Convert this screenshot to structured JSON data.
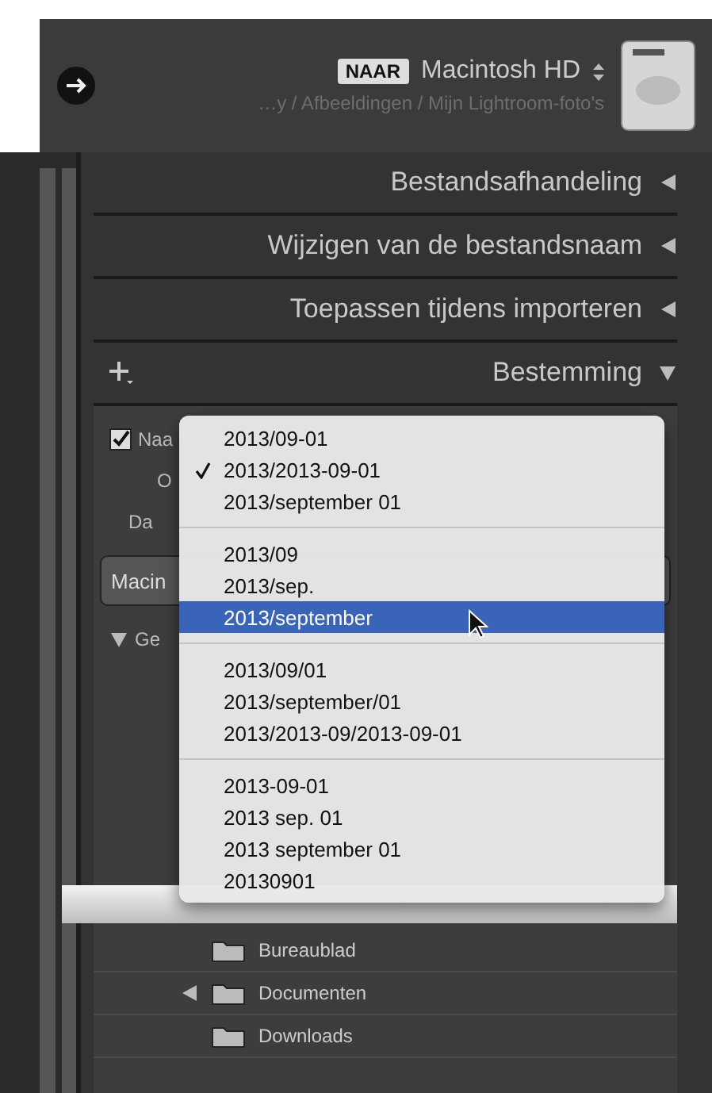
{
  "header": {
    "badge": "NAAR",
    "volume": "Macintosh HD",
    "path": "…y / Afbeeldingen / Mijn Lightroom-foto's"
  },
  "panels": [
    {
      "title": "Bestandsafhandeling",
      "expanded": false
    },
    {
      "title": "Wijzigen van de bestandsnaam",
      "expanded": false
    },
    {
      "title": "Toepassen tijdens importeren",
      "expanded": false
    },
    {
      "title": "Bestemming",
      "expanded": true
    }
  ],
  "destination": {
    "subfolder": {
      "label": "Naa",
      "checked": true
    },
    "organize_label": "O",
    "date_label": "Da",
    "volume_bar": "Macin",
    "tree_header": "Ge"
  },
  "menu": [
    [
      {
        "label": "2013/09-01",
        "checked": false,
        "selected": false
      },
      {
        "label": "2013/2013-09-01",
        "checked": true,
        "selected": false
      },
      {
        "label": "2013/september 01",
        "checked": false,
        "selected": false
      }
    ],
    [
      {
        "label": "2013/09",
        "checked": false,
        "selected": false
      },
      {
        "label": "2013/sep.",
        "checked": false,
        "selected": false
      },
      {
        "label": "2013/september",
        "checked": false,
        "selected": true
      }
    ],
    [
      {
        "label": "2013/09/01",
        "checked": false,
        "selected": false
      },
      {
        "label": "2013/september/01",
        "checked": false,
        "selected": false
      },
      {
        "label": "2013/2013-09/2013-09-01",
        "checked": false,
        "selected": false
      }
    ],
    [
      {
        "label": "2013-09-01",
        "checked": false,
        "selected": false
      },
      {
        "label": "2013 sep. 01",
        "checked": false,
        "selected": false
      },
      {
        "label": "2013 september 01",
        "checked": false,
        "selected": false
      },
      {
        "label": "20130901",
        "checked": false,
        "selected": false
      }
    ]
  ],
  "folders": [
    {
      "name": "Bureaublad",
      "has_children": false
    },
    {
      "name": "Documenten",
      "has_children": true
    },
    {
      "name": "Downloads",
      "has_children": false
    }
  ]
}
